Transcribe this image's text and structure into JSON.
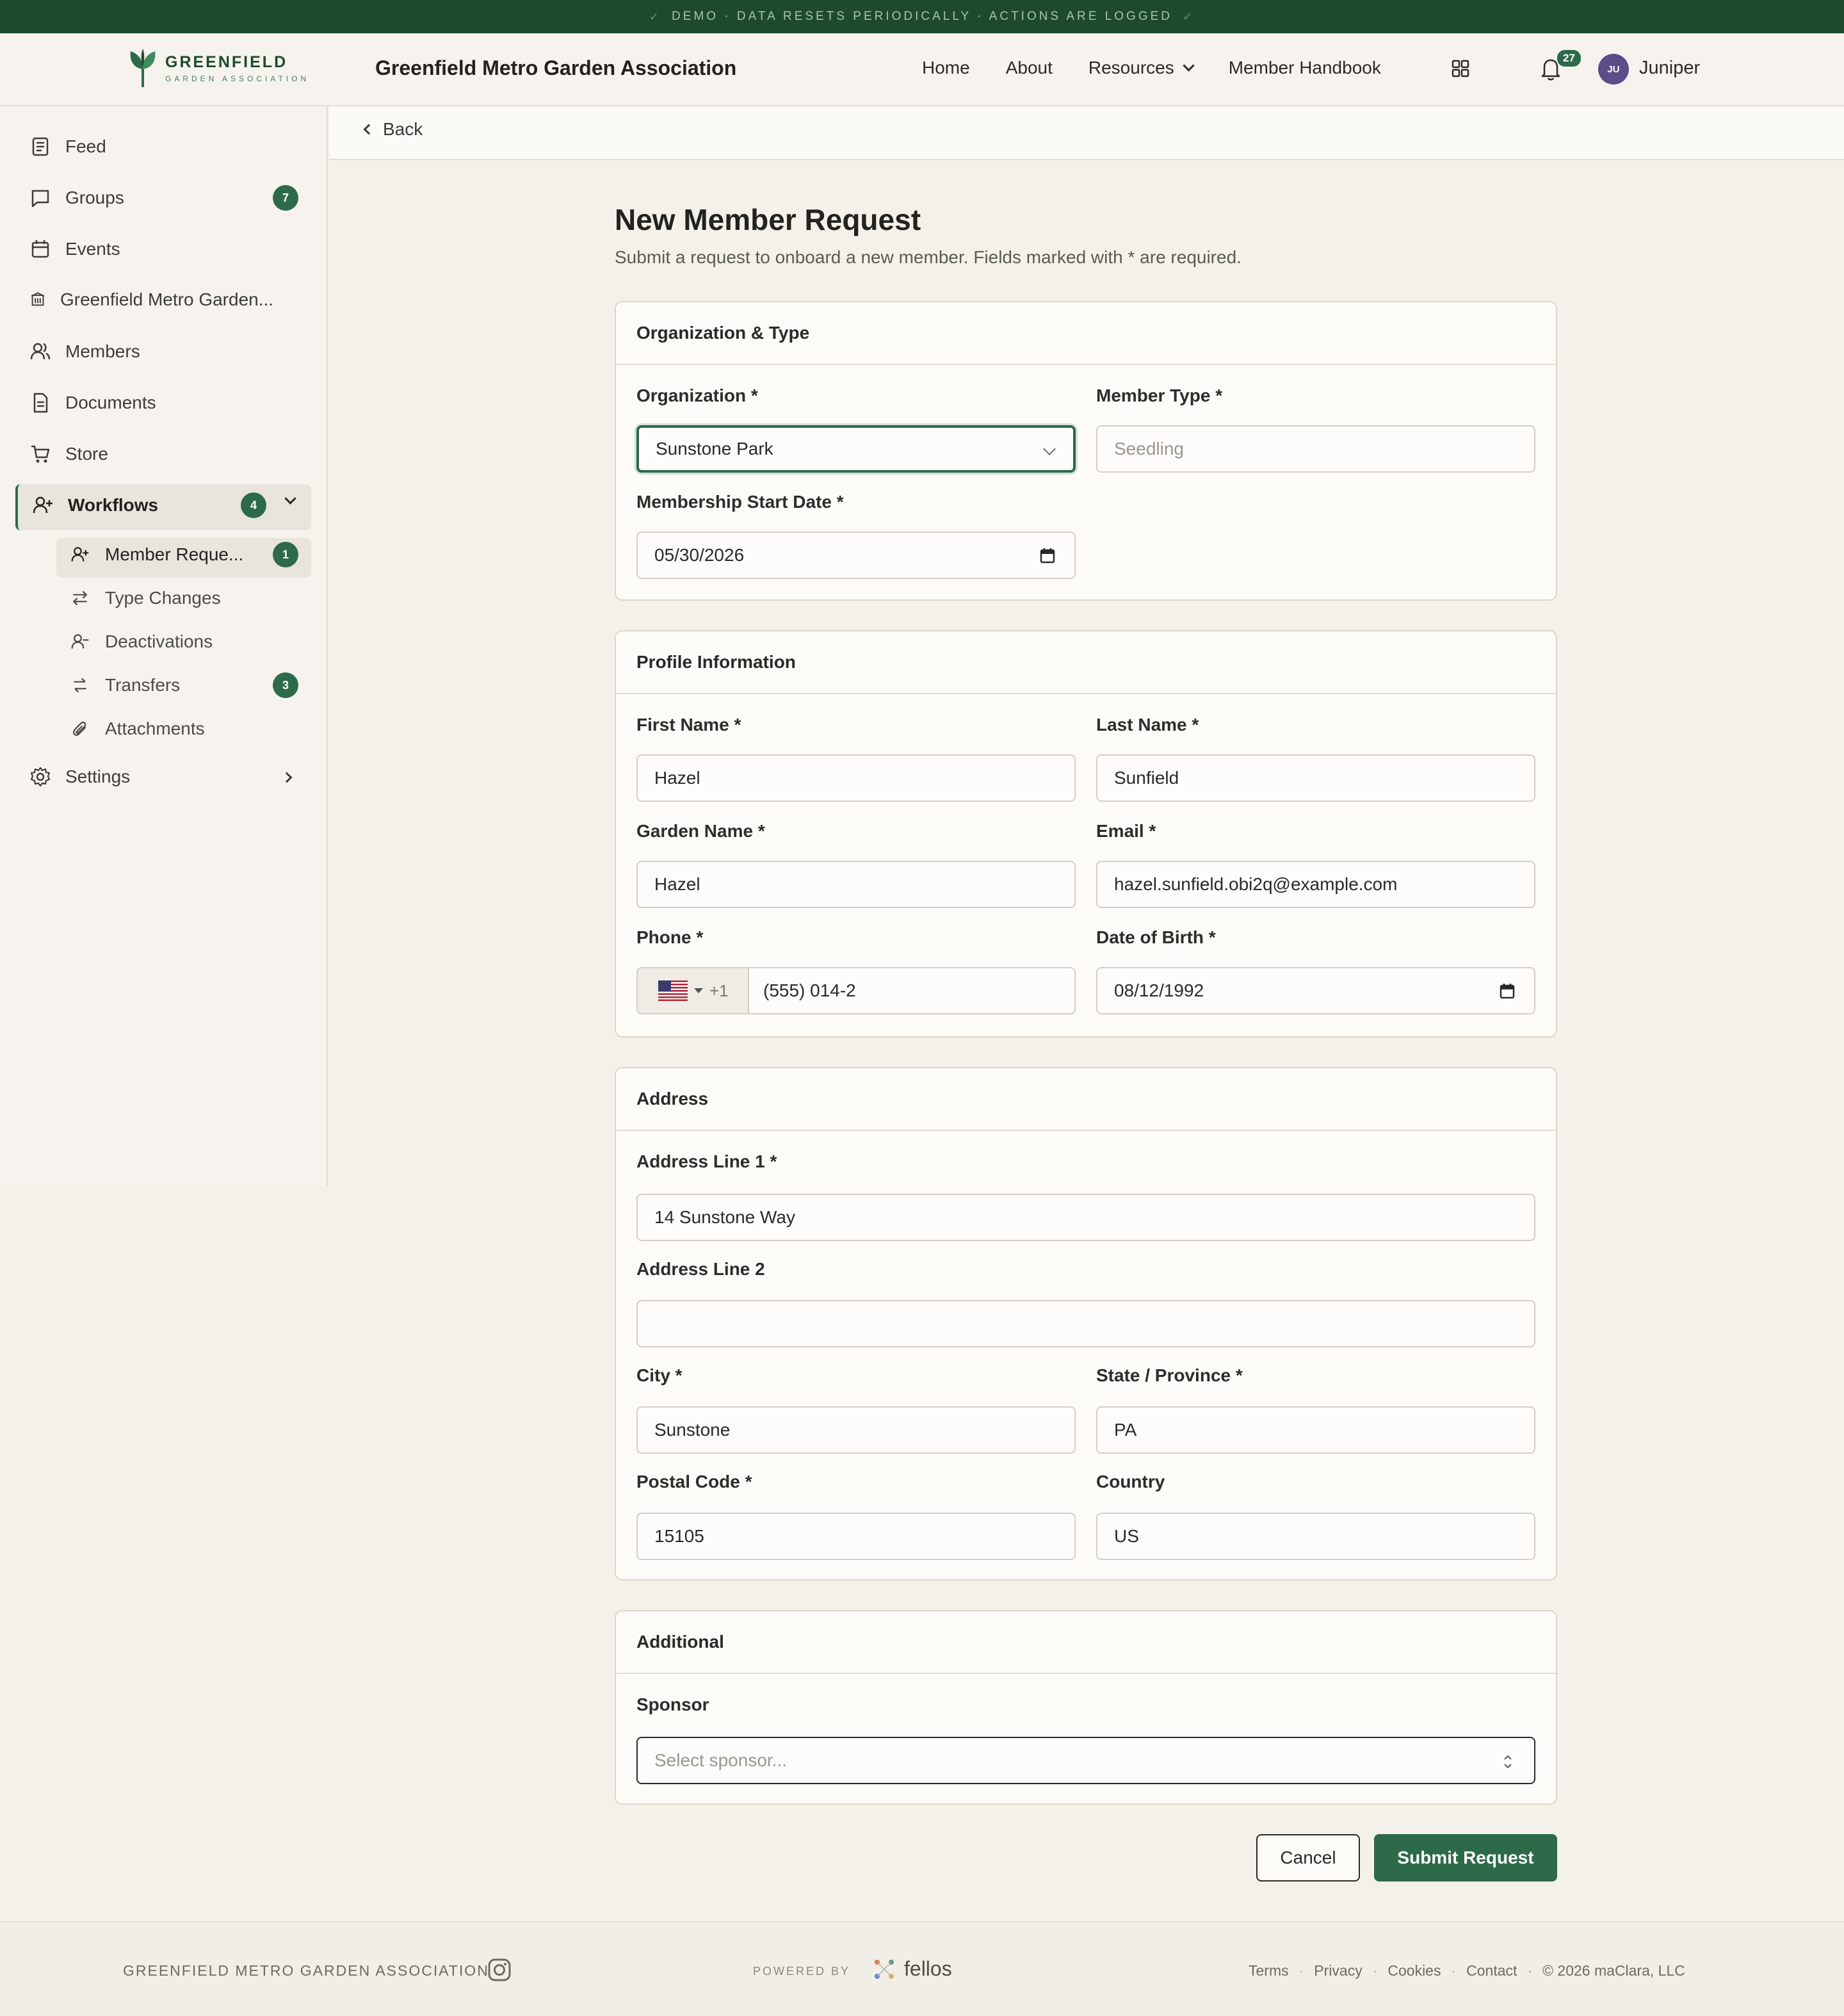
{
  "banner": {
    "text": "DEMO · DATA RESETS PERIODICALLY · ACTIONS ARE LOGGED"
  },
  "header": {
    "logo_name": "GREENFIELD",
    "logo_sub": "GARDEN ASSOCIATION",
    "org_title": "Greenfield Metro Garden Association",
    "nav": [
      "Home",
      "About",
      "Resources",
      "Member Handbook"
    ],
    "notifications_count": "27",
    "avatar_initials": "JU",
    "user_name": "Juniper"
  },
  "sidebar": {
    "items": [
      {
        "label": "Feed",
        "icon": "feed-icon"
      },
      {
        "label": "Groups",
        "icon": "chat-icon",
        "badge": "7"
      },
      {
        "label": "Events",
        "icon": "calendar-icon"
      },
      {
        "label": "Greenfield Metro Garden...",
        "icon": "building-icon"
      },
      {
        "label": "Members",
        "icon": "users-icon"
      },
      {
        "label": "Documents",
        "icon": "document-icon"
      },
      {
        "label": "Store",
        "icon": "cart-icon"
      },
      {
        "label": "Workflows",
        "icon": "user-plus-icon",
        "badge": "4"
      },
      {
        "label": "Settings",
        "icon": "gear-icon"
      }
    ],
    "workflows_sub": [
      {
        "label": "Member Reque...",
        "icon": "user-plus-icon",
        "badge": "1"
      },
      {
        "label": "Type Changes",
        "icon": "swap-icon"
      },
      {
        "label": "Deactivations",
        "icon": "user-minus-icon"
      },
      {
        "label": "Transfers",
        "icon": "transfer-icon",
        "badge": "3"
      },
      {
        "label": "Attachments",
        "icon": "paperclip-icon"
      }
    ]
  },
  "back_label": "Back",
  "page": {
    "title": "New Member Request",
    "subtitle": "Submit a request to onboard a new member. Fields marked with * are required."
  },
  "sections": {
    "org": {
      "title": "Organization & Type",
      "organization_label": "Organization *",
      "organization_value": "Sunstone Park",
      "member_type_label": "Member Type *",
      "member_type_value": "Seedling",
      "start_date_label": "Membership Start Date *",
      "start_date_value": "05/30/2026"
    },
    "profile": {
      "title": "Profile Information",
      "first_name_label": "First Name *",
      "first_name_value": "Hazel",
      "last_name_label": "Last Name *",
      "last_name_value": "Sunfield",
      "garden_name_label": "Garden Name *",
      "garden_name_value": "Hazel",
      "email_label": "Email *",
      "email_value": "hazel.sunfield.obi2q@example.com",
      "phone_label": "Phone *",
      "phone_code": "+1",
      "phone_value": "(555) 014-2",
      "dob_label": "Date of Birth *",
      "dob_value": "08/12/1992"
    },
    "address": {
      "title": "Address",
      "line1_label": "Address Line 1 *",
      "line1_value": "14 Sunstone Way",
      "line2_label": "Address Line 2",
      "line2_value": "",
      "city_label": "City *",
      "city_value": "Sunstone",
      "state_label": "State / Province *",
      "state_value": "PA",
      "postal_label": "Postal Code *",
      "postal_value": "15105",
      "country_label": "Country",
      "country_value": "US"
    },
    "additional": {
      "title": "Additional",
      "sponsor_label": "Sponsor",
      "sponsor_placeholder": "Select sponsor..."
    }
  },
  "actions": {
    "cancel": "Cancel",
    "submit": "Submit Request"
  },
  "footer": {
    "org": "GREENFIELD METRO GARDEN ASSOCIATION",
    "powered_by": "POWERED BY",
    "brand": "fellos",
    "links": [
      "Terms",
      "Privacy",
      "Cookies",
      "Contact",
      "© 2026 maClara, LLC"
    ]
  },
  "colors": {
    "accent": "#2d6a4a",
    "banner": "#1d4a2d",
    "background": "#f4f1eb"
  }
}
